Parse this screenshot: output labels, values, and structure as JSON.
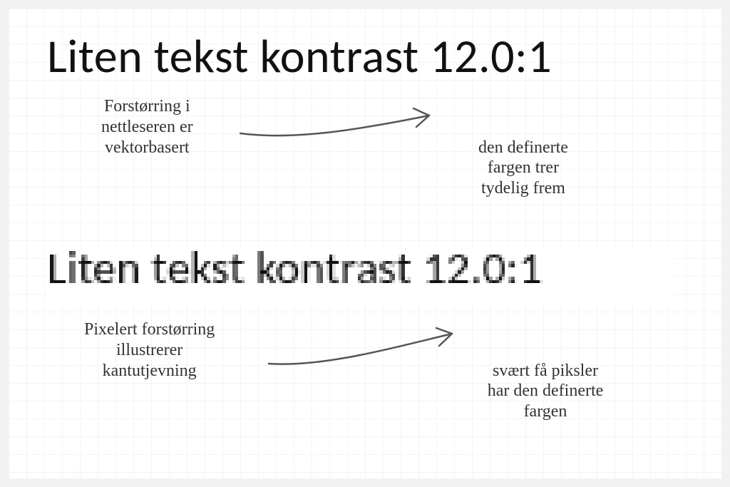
{
  "heading_top": "Liten tekst kontrast 12.0:1",
  "heading_bottom": "Liten tekst kontrast 12.0:1",
  "note_top_left": "Forstørring i\nnettleseren er\nvektorbasert",
  "note_top_right": "den definerte\nfargen trer\ntydelig frem",
  "note_bottom_left": "Pixelert forstørring\nillustrerer\nkantutjevning",
  "note_bottom_right": "svært få piksler\nhar den definerte\nfargen"
}
